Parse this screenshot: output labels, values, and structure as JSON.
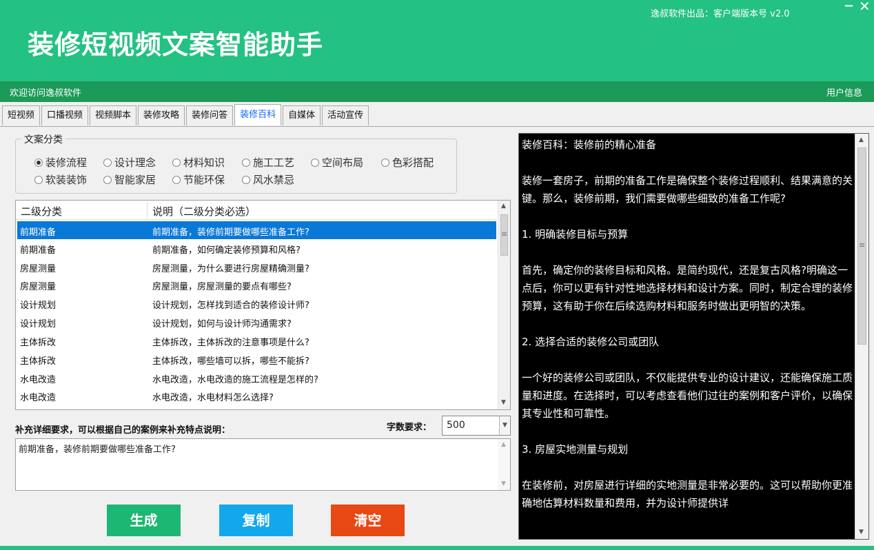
{
  "header": {
    "title": "装修短视频文案智能助手",
    "version": "逸叔软件出品：客户端版本号 v2.0",
    "minimize_icon": "minimize-icon",
    "close_icon": "close-icon"
  },
  "welcome_bar": {
    "welcome": "欢迎访问逸叔软件",
    "user_info": "用户信息"
  },
  "tabs": [
    "短视频",
    "口播视频",
    "视频脚本",
    "装修攻略",
    "装修问答",
    "装修百科",
    "自媒体",
    "活动宣传"
  ],
  "active_tab": "装修百科",
  "category": {
    "title": "文案分类",
    "options": [
      "装修流程",
      "设计理念",
      "材料知识",
      "施工工艺",
      "空间布局",
      "色彩搭配",
      "软装装饰",
      "智能家居",
      "节能环保",
      "风水禁忌"
    ],
    "selected": "装修流程"
  },
  "list": {
    "headers": [
      "二级分类",
      "说明（二级分类必选）"
    ],
    "rows": [
      [
        "前期准备",
        "前期准备，装修前期要做哪些准备工作?"
      ],
      [
        "前期准备",
        "前期准备，如何确定装修预算和风格?"
      ],
      [
        "房屋测量",
        "房屋测量，为什么要进行房屋精确测量?"
      ],
      [
        "房屋测量",
        "房屋测量，房屋测量的要点有哪些?"
      ],
      [
        "设计规划",
        "设计规划，怎样找到适合的装修设计师?"
      ],
      [
        "设计规划",
        "设计规划，如何与设计师沟通需求?"
      ],
      [
        "主体拆改",
        "主体拆改，主体拆改的注意事项是什么?"
      ],
      [
        "主体拆改",
        "主体拆改，哪些墙可以拆，哪些不能拆?"
      ],
      [
        "水电改造",
        "水电改造，水电改造的施工流程是怎样的?"
      ],
      [
        "水电改造",
        "水电改造，水电材料怎么选择?"
      ]
    ],
    "selected_index": 0
  },
  "supplement": {
    "label": "补充详细要求，可以根据自己的案例来补充特点说明：",
    "text": "前期准备，装修前期要做哪些准备工作?"
  },
  "word_count": {
    "label": "字数要求：",
    "value": "500"
  },
  "buttons": {
    "generate": "生成",
    "copy": "复制",
    "clear": "清空"
  },
  "colors": {
    "brand_green": "#23c182",
    "dark_green": "#1b9a59",
    "generate": "#1cb773",
    "copy": "#12a8ea",
    "clear": "#e84813",
    "selection": "#0a78d7"
  },
  "output": {
    "text": "装修百科：装修前的精心准备\n\n装修一套房子，前期的准备工作是确保整个装修过程顺利、结果满意的关键。那么，装修前期，我们需要做哪些细致的准备工作呢?\n\n1. 明确装修目标与预算\n\n首先，确定你的装修目标和风格。是简约现代，还是复古风格?明确这一点后，你可以更有针对性地选择材料和设计方案。同时，制定合理的装修预算，这有助于你在后续选购材料和服务时做出更明智的决策。\n\n2. 选择合适的装修公司或团队\n\n一个好的装修公司或团队，不仅能提供专业的设计建议，还能确保施工质量和进度。在选择时，可以考虑查看他们过往的案例和客户评价，以确保其专业性和可靠性。\n\n3. 房屋实地测量与规划\n\n在装修前，对房屋进行详细的实地测量是非常必要的。这可以帮助你更准确地估算材料数量和费用，并为设计师提供详"
  }
}
